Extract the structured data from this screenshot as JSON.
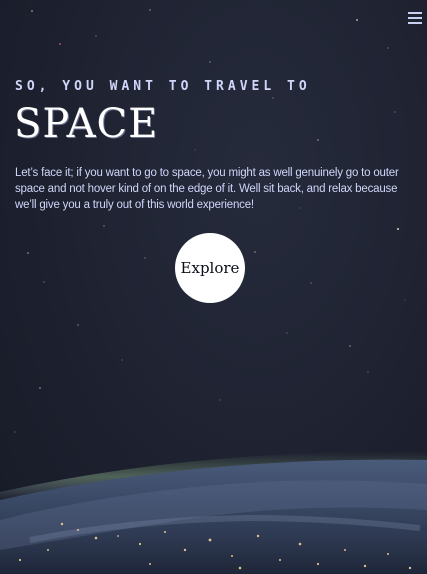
{
  "nav": {
    "menu_icon": "hamburger-menu-icon"
  },
  "hero": {
    "eyebrow": "SO, YOU WANT TO TRAVEL TO",
    "title": "SPACE",
    "description": "Let’s face it; if you want to go to space, you might as well genuinely go to outer space and not hover kind of on the edge of it. Well sit back, and relax because we’ll give you a truly out of this world experience!",
    "cta_label": "Explore"
  },
  "colors": {
    "background": "#1F2332",
    "text_light": "#D0D6F9",
    "white": "#FFFFFF",
    "dark": "#0B0D17"
  }
}
